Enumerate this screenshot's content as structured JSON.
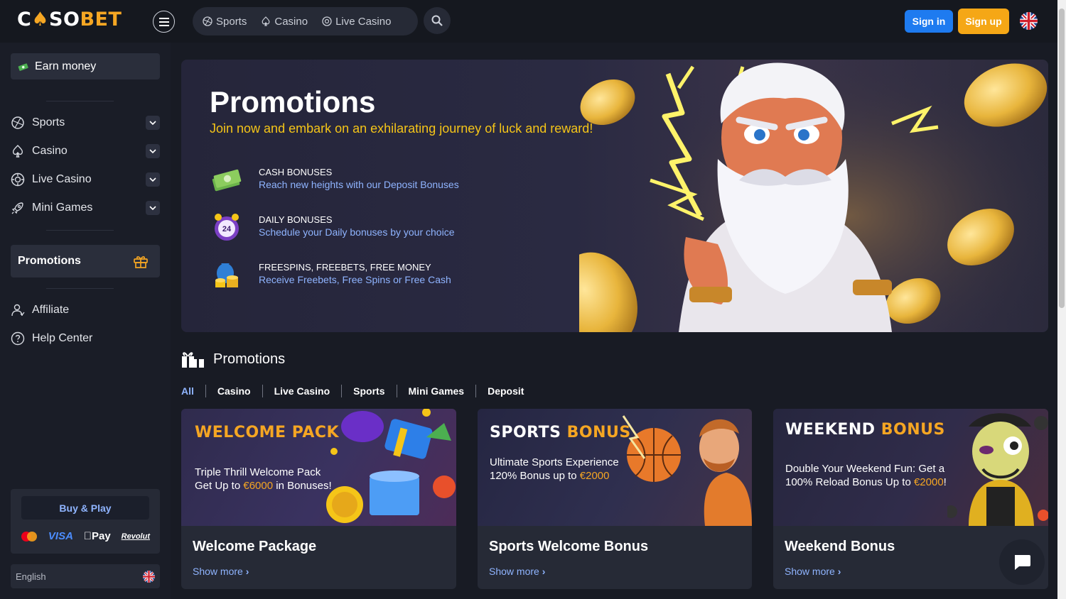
{
  "header": {
    "logo_pre": "C",
    "logo_mid": "SO",
    "logo_bet": "BET",
    "nav": [
      "Sports",
      "Casino",
      "Live Casino"
    ],
    "sign_in": "Sign in",
    "sign_up": "Sign up"
  },
  "sidebar": {
    "earn": "Earn money",
    "items": [
      {
        "label": "Sports"
      },
      {
        "label": "Casino"
      },
      {
        "label": "Live Casino"
      },
      {
        "label": "Mini Games"
      }
    ],
    "promotions": "Promotions",
    "affiliate": "Affiliate",
    "help": "Help Center",
    "buy_play": "Buy & Play",
    "pay_visa": "VISA",
    "pay_apple": "Pay",
    "pay_revolut": "Revolut",
    "language": "English"
  },
  "hero": {
    "title": "Promotions",
    "subtitle": "Join now and embark on an exhilarating journey of luck and reward!",
    "features": [
      {
        "title": "CASH BONUSES",
        "desc": "Reach new heights with our Deposit Bonuses"
      },
      {
        "title": "DAILY BONUSES",
        "desc": "Schedule your Daily bonuses by your choice"
      },
      {
        "title": "FREESPINS, FREEBETS, FREE MONEY",
        "desc": "Receive Freebets, Free Spins or Free Cash"
      }
    ]
  },
  "section": {
    "title": "Promotions",
    "filters": [
      "All",
      "Casino",
      "Live Casino",
      "Sports",
      "Mini Games",
      "Deposit"
    ]
  },
  "cards": [
    {
      "head_a": "WELCOME",
      "head_b": "PACK",
      "line1": "Triple Thrill Welcome Pack",
      "line2_a": "Get Up to ",
      "line2_b": "€6000",
      "line2_c": " in Bonuses!",
      "title": "Welcome Package",
      "more": "Show more"
    },
    {
      "head_a": "SPORTS",
      "head_b": "BONUS",
      "line1": "Ultimate Sports Experience",
      "line2_a": "120% Bonus up to ",
      "line2_b": "€2000",
      "line2_c": "",
      "title": "Sports Welcome Bonus",
      "more": "Show more"
    },
    {
      "head_a": "WEEKEND",
      "head_b": "BONUS",
      "line1": "Double Your Weekend Fun: Get a",
      "line2_a": "100% Reload Bonus Up to ",
      "line2_b": "€2000",
      "line2_c": "!",
      "title": "Weekend Bonus",
      "more": "Show more"
    }
  ],
  "colors": {
    "accent": "#f5a623",
    "link": "#8fb4ff",
    "primary": "#1e7bf0",
    "bg": "#181b24"
  }
}
